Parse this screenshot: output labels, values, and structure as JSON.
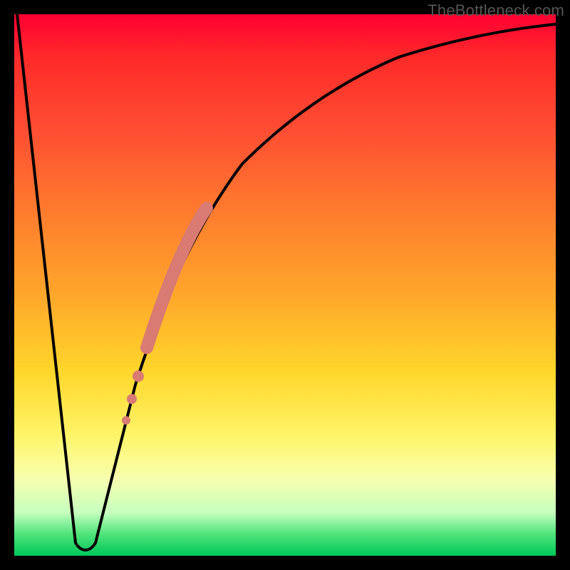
{
  "watermark": "TheBottleneck.com",
  "colors": {
    "frame": "#000000",
    "gradient_top": "#ff0033",
    "gradient_mid_orange": "#ffa72b",
    "gradient_mid_yellow": "#fff56a",
    "gradient_bottom": "#00c85a",
    "curve": "#000000",
    "highlight": "#d97b72"
  },
  "chart_data": {
    "type": "line",
    "title": "",
    "xlabel": "",
    "ylabel": "",
    "xlim": [
      0,
      100
    ],
    "ylim": [
      0,
      100
    ],
    "x": [
      0,
      2,
      4,
      6,
      8,
      10,
      12,
      14,
      16,
      18,
      20,
      22,
      24,
      26,
      28,
      30,
      35,
      40,
      45,
      50,
      55,
      60,
      65,
      70,
      75,
      80,
      85,
      90,
      95,
      100
    ],
    "y": [
      100,
      82,
      64,
      46,
      28,
      10,
      1,
      1,
      10,
      23,
      34,
      43,
      50,
      56,
      61,
      65,
      73,
      79,
      84,
      87,
      90,
      92,
      93.5,
      95,
      96,
      96.8,
      97.4,
      97.8,
      98.2,
      98.5
    ],
    "valley_x_range": [
      11,
      14
    ],
    "highlight_segments": [
      {
        "x_start": 20,
        "x_end": 21,
        "type": "dot"
      },
      {
        "x_start": 22,
        "x_end": 23,
        "type": "dot"
      },
      {
        "x_start": 25,
        "x_end": 35,
        "type": "thick"
      }
    ],
    "legend": [],
    "annotations": []
  }
}
